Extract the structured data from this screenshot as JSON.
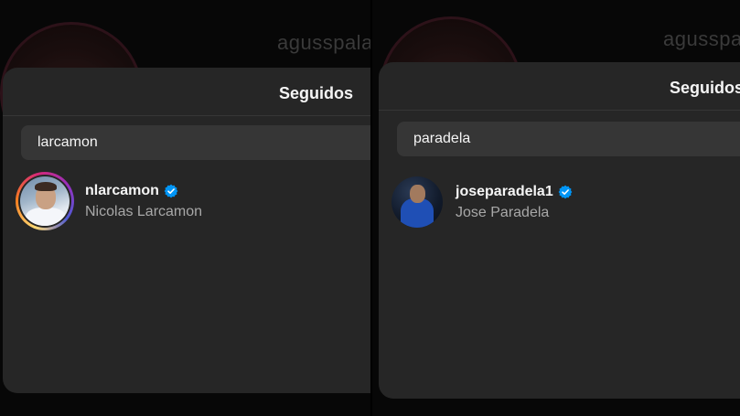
{
  "panels": [
    {
      "background_username": "agusspala",
      "modal": {
        "title": "Seguidos",
        "search": {
          "value": "larcamon"
        },
        "result": {
          "username": "nlarcamon",
          "full_name": "Nicolas Larcamon",
          "verified": true,
          "story_ring": true
        }
      }
    },
    {
      "background_username": "agusspala",
      "modal": {
        "title": "Seguidos",
        "search": {
          "value": "paradela"
        },
        "result": {
          "username": "joseparadela1",
          "full_name": "Jose Paradela",
          "verified": true,
          "story_ring": false
        }
      }
    }
  ],
  "colors": {
    "modal_bg": "#262626",
    "search_bg": "#363636",
    "verified_blue": "#0095f6",
    "secondary_text": "#a8a8a8"
  }
}
